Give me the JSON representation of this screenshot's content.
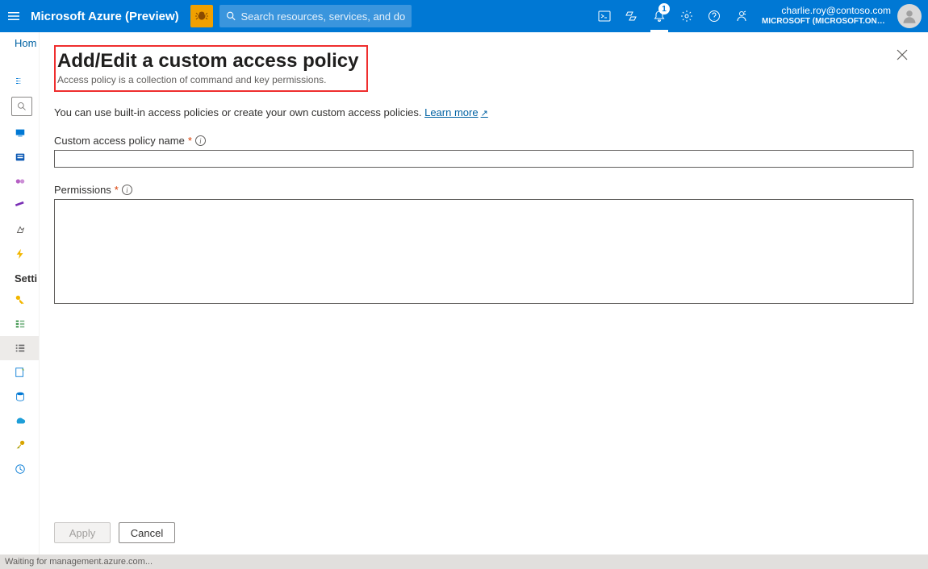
{
  "header": {
    "brand": "Microsoft Azure (Preview)",
    "search_placeholder": "Search resources, services, and docs (G+/)",
    "notif_count": "1",
    "account_email": "charlie.roy@contoso.com",
    "account_tenant": "MICROSOFT (MICROSOFT.ONMI..."
  },
  "breadcrumb": {
    "root": "Hom"
  },
  "sidebar": {
    "section_label": "Setti"
  },
  "blade": {
    "title": "Add/Edit a custom access policy",
    "subtitle": "Access policy is a collection of command and key permissions.",
    "intro": "You can use built-in access policies or create your own custom access policies.",
    "learn_more": "Learn more",
    "fields": {
      "name_label": "Custom access policy name",
      "name_value": "",
      "perm_label": "Permissions",
      "perm_value": ""
    },
    "buttons": {
      "apply": "Apply",
      "cancel": "Cancel"
    }
  },
  "statusbar": {
    "text": "Waiting for management.azure.com..."
  }
}
